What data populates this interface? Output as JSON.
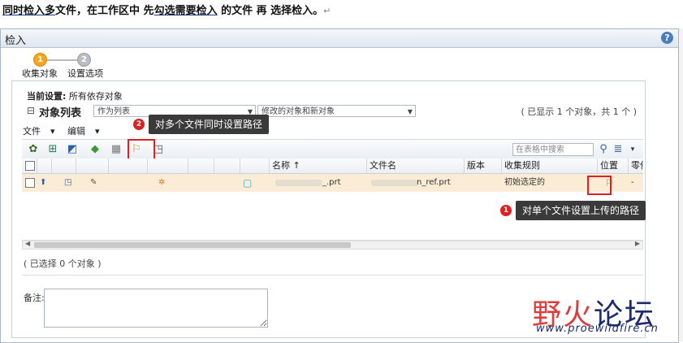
{
  "caption": {
    "p1": "同时",
    "p2": "检入多",
    "p3": "文件，在工作区中 先",
    "p4": "勾选需要检入",
    "p5": " 的文件 再 选择检入。",
    "mark": "↵"
  },
  "window": {
    "title": "检入",
    "help_icon": "help-icon"
  },
  "steps": [
    {
      "num": "1",
      "label": "收集对象",
      "state": "active"
    },
    {
      "num": "2",
      "label": "设置选项",
      "state": "inactive"
    }
  ],
  "current": {
    "label": "当前设置:",
    "value": "所有依存对象"
  },
  "object_list": {
    "collapse": "⊟",
    "title": "对象列表",
    "view_select": "作为列表",
    "filter_select": "修改的对象和新对象",
    "count_text": "( 已显示 1 个对象，共 1 个 )"
  },
  "menu": {
    "file": "文件",
    "edit": "编辑"
  },
  "toolbar": {
    "search_placeholder": "在表格中搜索"
  },
  "table": {
    "columns": [
      "名称 ↑",
      "文件名",
      "版本",
      "收集规则",
      "位置",
      "零件"
    ],
    "row": {
      "name": "_.prt",
      "filename": "n_ref.prt",
      "version": "",
      "rule": "初始选定的",
      "location": "",
      "part": "-"
    }
  },
  "selected_count": "( 已选择 0 个对象 )",
  "note_label": "备注:",
  "annotations": {
    "tip1": {
      "num": "1",
      "text": "对单个文件设置上传的路径"
    },
    "tip2": {
      "num": "2",
      "text": "对多个文件同时设置路径"
    }
  },
  "watermark": {
    "text_a": "野火",
    "text_b": "论坛",
    "url": "www.proewildfire.cn"
  },
  "colors": {
    "accent_red": "#e02020",
    "step_active": "#f5a623",
    "row_highlight": "#fbecd6"
  }
}
